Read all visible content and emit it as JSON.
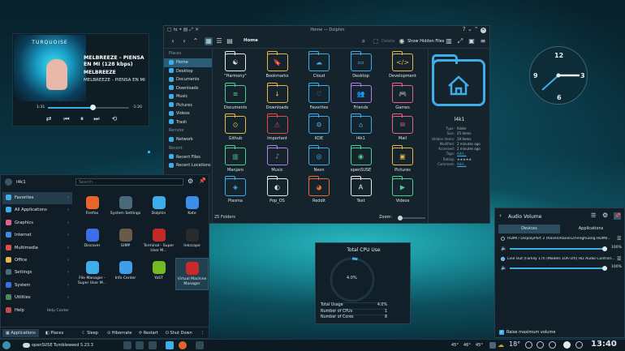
{
  "player": {
    "track": "MELBREEZE - PIENSA EN MI (128 kbps)",
    "artist": "MELBREEZE",
    "album": "MELBREEZE - PIENSA EN MI",
    "album_art_text": "TURQUOISE",
    "time_current": "1:31",
    "time_total": "-1:20",
    "progress": 0.55
  },
  "dolphin": {
    "title": "Home — Dolphin",
    "breadcrumb": "Home",
    "delete_label": "Delete",
    "show_hidden": "Show Hidden Files",
    "places_header": "Places",
    "places": [
      "Home",
      "Desktop",
      "Documents",
      "Downloads",
      "Music",
      "Pictures",
      "Videos",
      "Trash"
    ],
    "remote_header": "Remote",
    "remote": [
      "Network"
    ],
    "recent_header": "Recent",
    "recent": [
      "Recent Files",
      "Recent Locations"
    ],
    "folders": [
      {
        "name": "\"Harmony\"",
        "color": "#e8e8e8",
        "glyph": "☯"
      },
      {
        "name": "Bookmarks",
        "color": "#e6b84a",
        "glyph": "🔖"
      },
      {
        "name": "Cloud",
        "color": "#3daee9",
        "glyph": "☁"
      },
      {
        "name": "Desktop",
        "color": "#3daee9",
        "glyph": "▭"
      },
      {
        "name": "Development",
        "color": "#e6b84a",
        "glyph": "</>"
      },
      {
        "name": "Documents",
        "color": "#4ecf8f",
        "glyph": "≡"
      },
      {
        "name": "Downloads",
        "color": "#e6b84a",
        "glyph": "↓"
      },
      {
        "name": "Favorites",
        "color": "#3daee9",
        "glyph": "♡"
      },
      {
        "name": "Friends",
        "color": "#b080e8",
        "glyph": "👥"
      },
      {
        "name": "Games",
        "color": "#e8608a",
        "glyph": "🎮"
      },
      {
        "name": "Github",
        "color": "#e6b84a",
        "glyph": "⊙"
      },
      {
        "name": "Important",
        "color": "#e84a4a",
        "glyph": "⚠"
      },
      {
        "name": "KDE",
        "color": "#3daee9",
        "glyph": "⚙"
      },
      {
        "name": "l4k1",
        "color": "#3daee9",
        "glyph": "⌂"
      },
      {
        "name": "Mail",
        "color": "#e8608a",
        "glyph": "✉"
      },
      {
        "name": "Manjaro",
        "color": "#4ecf8f",
        "glyph": "▥"
      },
      {
        "name": "Music",
        "color": "#b080e8",
        "glyph": "♪"
      },
      {
        "name": "Neon",
        "color": "#3daee9",
        "glyph": "◎"
      },
      {
        "name": "openSUSE",
        "color": "#4ecf8f",
        "glyph": "◉"
      },
      {
        "name": "Pictures",
        "color": "#e6b84a",
        "glyph": "▣"
      },
      {
        "name": "Plasma",
        "color": "#3daee9",
        "glyph": "◈"
      },
      {
        "name": "Pop_OS",
        "color": "#e8e8e8",
        "glyph": "◐"
      },
      {
        "name": "Reddit",
        "color": "#e86a3a",
        "glyph": "◕"
      },
      {
        "name": "Text",
        "color": "#e8e8e8",
        "glyph": "A"
      },
      {
        "name": "Videos",
        "color": "#4ecf8f",
        "glyph": "▶"
      }
    ],
    "info": {
      "name": "l4k1",
      "rows": [
        [
          "Type:",
          "folder"
        ],
        [
          "Size:",
          "25 items"
        ],
        [
          "Hidden items:",
          "19 items"
        ],
        [
          "Modified:",
          "2 minutes ago"
        ],
        [
          "Accessed:",
          "2 minutes ago"
        ],
        [
          "Tags:",
          "Add..."
        ],
        [
          "Rating:",
          "★★★★★"
        ],
        [
          "Comment:",
          "Add..."
        ]
      ]
    },
    "status": "25 Folders",
    "zoom_label": "Zoom:"
  },
  "clock": {
    "n12": "12",
    "n3": "3",
    "n6": "6",
    "n9": "9"
  },
  "launcher": {
    "user": "l4k1",
    "search_placeholder": "Search...",
    "categories": [
      "Favorites",
      "All Applications",
      "Graphics",
      "Internet",
      "Multimedia",
      "Office",
      "Settings",
      "System",
      "Utilities",
      "Help"
    ],
    "help_center": "Help Center",
    "apps": [
      {
        "name": "Firefox",
        "color": "#e8642a"
      },
      {
        "name": "System Settings",
        "color": "#4a6a7a"
      },
      {
        "name": "Dolphin",
        "color": "#3daee9"
      },
      {
        "name": "Kate",
        "color": "#3d8ee9"
      },
      {
        "name": "Discover",
        "color": "#3d6ee9"
      },
      {
        "name": "GIMP",
        "color": "#6a5a4a"
      },
      {
        "name": "Terminal - Super User M...",
        "color": "#c22a2a"
      },
      {
        "name": "Inkscape",
        "color": "#2a2a2a"
      },
      {
        "name": "File Manager - Super User M...",
        "color": "#3daee9"
      },
      {
        "name": "Info Center",
        "color": "#3d9ee9"
      },
      {
        "name": "YaST",
        "color": "#73ba25"
      },
      {
        "name": "Virtual Machine Manager",
        "color": "#c82a2a"
      }
    ],
    "footer": {
      "applications": "Applications",
      "places": "Places",
      "sleep": "Sleep",
      "hibernate": "Hibernate",
      "restart": "Restart",
      "shutdown": "Shut Down"
    }
  },
  "cpu": {
    "title": "Total CPU Use",
    "center": "4.0%",
    "rows": [
      [
        "Total Usage",
        "4.0%"
      ],
      [
        "Number of CPUs",
        "1"
      ],
      [
        "Number of Cores",
        "8"
      ]
    ]
  },
  "audio": {
    "title": "Audio Volume",
    "tab_devices": "Devices",
    "tab_apps": "Applications",
    "dev1": "HDMI / DisplayPort 2 (Raven/Raven2/Fenghuang HDMI/...",
    "dev1_pct": "100%",
    "dev1_level": 1.0,
    "dev2": "Line Out (Family 17h (Models 10h-1fh) HD Audio Controll...",
    "dev2_pct": "100%",
    "dev2_level": 1.0,
    "raise": "Raise maximum volume"
  },
  "taskbar": {
    "distro": "openSUSE",
    "release": "Tumbleweed 5.23.3",
    "temps": [
      "45°",
      "46°",
      "45°"
    ],
    "weather": "18°",
    "time": "13:40"
  }
}
